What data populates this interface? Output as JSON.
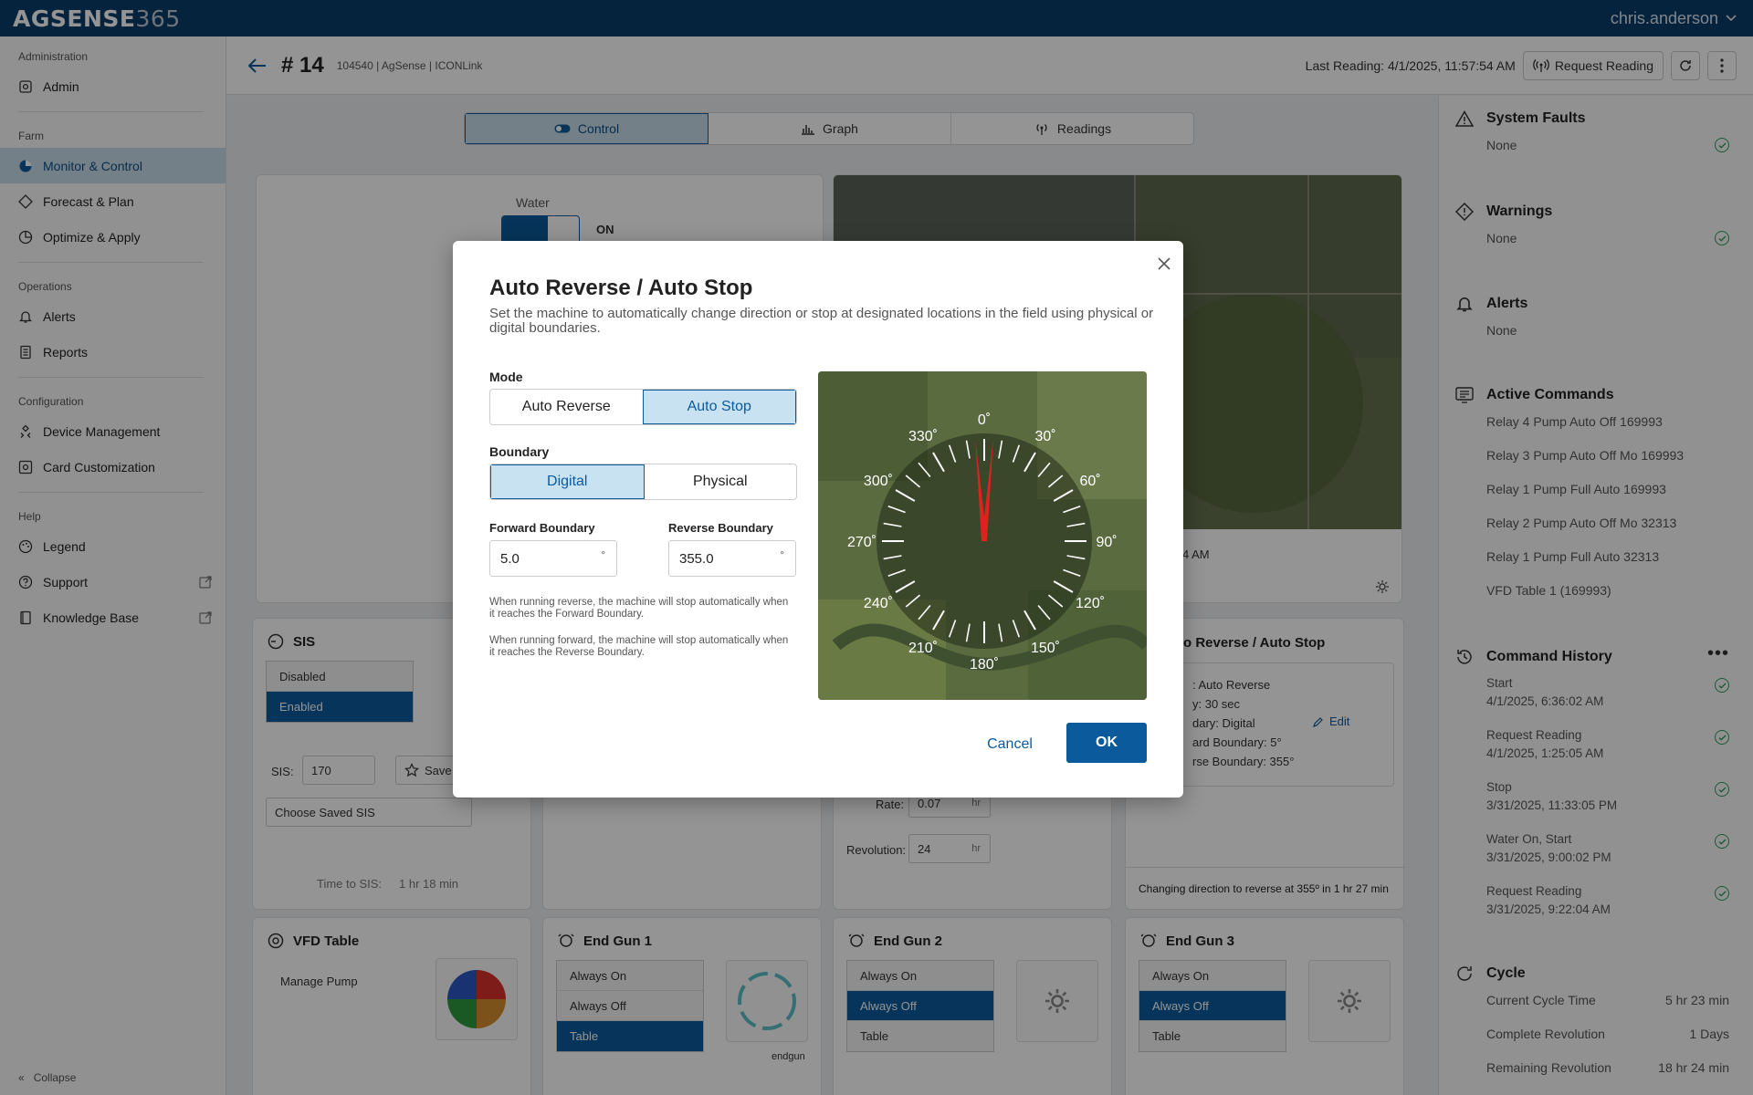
{
  "app": {
    "logo_main": "AGSENSE",
    "logo_num": "365",
    "user": "chris.anderson"
  },
  "sidebar": {
    "admin_section": "Administration",
    "admin": "Admin",
    "farm_section": "Farm",
    "monitor": "Monitor & Control",
    "forecast": "Forecast & Plan",
    "optimize": "Optimize & Apply",
    "ops_section": "Operations",
    "alerts": "Alerts",
    "reports": "Reports",
    "config_section": "Configuration",
    "device_mgmt": "Device Management",
    "card_custom": "Card Customization",
    "help_section": "Help",
    "legend": "Legend",
    "support": "Support",
    "kb": "Knowledge Base",
    "collapse": "Collapse"
  },
  "header": {
    "number": "# 14",
    "subtitle": "104540 | AgSense | ICONLink",
    "last_reading": "Last Reading: 4/1/2025, 11:57:54 AM",
    "request_reading": "Request Reading"
  },
  "tabs": [
    {
      "label": "Control"
    },
    {
      "label": "Graph"
    },
    {
      "label": "Readings"
    }
  ],
  "cards": {
    "water_label": "Water",
    "water_state": "ON",
    "map_time": "4 AM",
    "sis_title": "SIS",
    "sis_options": [
      "Disabled",
      "Enabled"
    ],
    "sis_label": "SIS:",
    "sis_value": "170",
    "save_label": "Save S",
    "choose_saved": "Choose Saved SIS",
    "time_to_sis_label": "Time to SIS:",
    "time_to_sis_value": "1 hr 18 min",
    "rate_label": "Rate:",
    "rate_value": "0.07",
    "rate_unit": "hr",
    "revolution_label": "Revolution:",
    "revolution_value": "24",
    "revolution_unit": "hr",
    "ar_title": "to Reverse / Auto Stop",
    "ar_lines": [
      ": Auto Reverse",
      "y: 30 sec",
      "dary: Digital",
      "ard Boundary: 5°",
      "rse Boundary: 355°"
    ],
    "ar_edit": "Edit",
    "ar_footer": "Changing direction to reverse at 355º in 1 hr 27 min",
    "vfd_title": "VFD Table",
    "manage_pump": "Manage Pump",
    "eg1_title": "End Gun 1",
    "eg2_title": "End Gun 2",
    "eg3_title": "End Gun 3",
    "eg_options": [
      "Always On",
      "Always Off",
      "Table"
    ],
    "endgun_caption": "endgun"
  },
  "right": {
    "faults_title": "System Faults",
    "faults_value": "None",
    "warnings_title": "Warnings",
    "warnings_value": "None",
    "alerts_title": "Alerts",
    "alerts_value": "None",
    "active_title": "Active Commands",
    "active": [
      "Relay 4 Pump Auto Off 169993",
      "Relay 3 Pump Auto Off Mo 169993",
      "Relay 1 Pump Full Auto 169993",
      "Relay 2 Pump Auto Off Mo 32313",
      "Relay 1 Pump Full Auto 32313",
      "VFD Table 1 (169993)"
    ],
    "history_title": "Command History",
    "history": [
      {
        "name": "Start",
        "time": "4/1/2025, 6:36:02 AM"
      },
      {
        "name": "Request Reading",
        "time": "4/1/2025, 1:25:05 AM"
      },
      {
        "name": "Stop",
        "time": "3/31/2025, 11:33:05 PM"
      },
      {
        "name": "Water On, Start",
        "time": "3/31/2025, 9:00:02 PM"
      },
      {
        "name": "Request Reading",
        "time": "3/31/2025, 9:22:04 AM"
      }
    ],
    "cycle_title": "Cycle",
    "cycle_rows": [
      {
        "label": "Current Cycle Time",
        "value": "5 hr 23 min"
      },
      {
        "label": "Complete Revolution",
        "value": "1 Days"
      },
      {
        "label": "Remaining Revolution",
        "value": "18 hr 24 min"
      }
    ]
  },
  "modal": {
    "title": "Auto Reverse / Auto Stop",
    "description": "Set the machine to automatically change direction or stop at designated locations in the field using physical or digital boundaries.",
    "mode_label": "Mode",
    "mode_options": [
      "Auto Reverse",
      "Auto Stop"
    ],
    "mode_selected": "Auto Stop",
    "boundary_label": "Boundary",
    "boundary_options": [
      "Digital",
      "Physical"
    ],
    "boundary_selected": "Digital",
    "forward_label": "Forward Boundary",
    "forward_value": "5.0",
    "reverse_label": "Reverse Boundary",
    "reverse_value": "355.0",
    "deg_symbol": "°",
    "note_reverse": "When running reverse, the machine will stop automatically when it reaches the Forward Boundary.",
    "note_forward": "When running forward, the machine will stop automatically when it reaches the Reverse Boundary.",
    "compass_labels": [
      "0˚",
      "30˚",
      "60˚",
      "90˚",
      "120˚",
      "150˚",
      "180˚",
      "210˚",
      "240˚",
      "270˚",
      "300˚",
      "330˚"
    ],
    "forward_deg": 5,
    "reverse_deg": 355,
    "cancel": "Cancel",
    "ok": "OK"
  }
}
